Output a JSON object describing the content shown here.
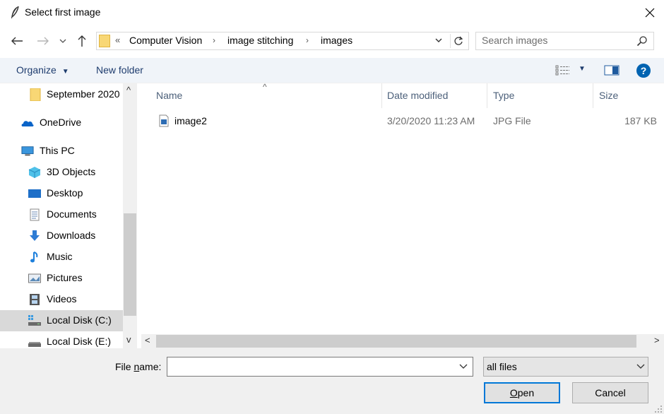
{
  "window": {
    "title": "Select first image",
    "icon": "feather-icon",
    "close_icon": "close-icon"
  },
  "navigation": {
    "back_icon": "arrow-left-icon",
    "forward_icon": "arrow-right-icon",
    "recent_icon": "chevron-down-icon",
    "up_icon": "arrow-up-icon"
  },
  "address_bar": {
    "overflow": "«",
    "breadcrumbs": [
      "Computer Vision",
      "image stitching",
      "images"
    ],
    "separator": "›",
    "refresh_icon": "refresh-icon"
  },
  "search": {
    "placeholder": "Search images",
    "value": ""
  },
  "toolbar": {
    "organize_label": "Organize",
    "organize_arrow": "▼",
    "new_folder_label": "New folder",
    "view_icon": "view-options-icon",
    "view_arrow": "▼",
    "preview_pane_icon": "preview-pane-icon",
    "help_icon": "help-icon",
    "help_glyph": "?"
  },
  "nav_pane": {
    "scroll_up": "^",
    "scroll_down": "v",
    "items": [
      {
        "label": "September 2020",
        "icon": "folder-icon"
      },
      {
        "label": "OneDrive",
        "icon": "cloud-icon"
      },
      {
        "label": "This PC",
        "icon": "computer-icon"
      },
      {
        "label": "3D Objects",
        "icon": "cube-icon"
      },
      {
        "label": "Desktop",
        "icon": "desktop-icon"
      },
      {
        "label": "Documents",
        "icon": "document-icon"
      },
      {
        "label": "Downloads",
        "icon": "download-icon"
      },
      {
        "label": "Music",
        "icon": "music-note-icon"
      },
      {
        "label": "Pictures",
        "icon": "pictures-icon"
      },
      {
        "label": "Videos",
        "icon": "film-icon"
      },
      {
        "label": "Local Disk (C:)",
        "icon": "drive-icon",
        "selected": true
      },
      {
        "label": "Local Disk (E:)",
        "icon": "drive-icon"
      }
    ]
  },
  "file_list": {
    "sort_indicator": "^",
    "columns": [
      "Name",
      "Date modified",
      "Type",
      "Size"
    ],
    "rows": [
      {
        "name": "image2",
        "date": "3/20/2020 11:23 AM",
        "type": "JPG File",
        "size": "187 KB",
        "icon": "image-file-icon"
      }
    ],
    "hscroll_left": "<",
    "hscroll_right": ">"
  },
  "bottom": {
    "file_name_label_pre": "File ",
    "file_name_label_u": "n",
    "file_name_label_post": "ame:",
    "file_name_value": "",
    "file_type": "all files",
    "open_u": "O",
    "open_rest": "pen",
    "cancel_label": "Cancel"
  },
  "colors": {
    "toolbar_bg": "#f0f4f9",
    "accent": "#0078d7",
    "help": "#0063b1",
    "folder": "#f8d775",
    "selection": "#d9d9d9"
  }
}
